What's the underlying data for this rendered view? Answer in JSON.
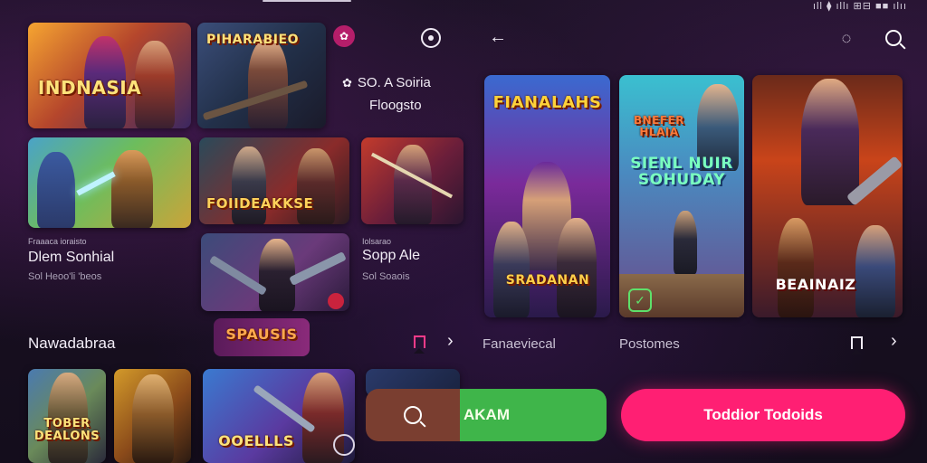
{
  "status_bar": {
    "text": "ıll ⧫ ıllı ⊞⊟ ■■ ılıı"
  },
  "left_panel": {
    "side_title": "SO. A Soiria",
    "side_subtitle": "Floogsto",
    "game_titles": {
      "g1": "INDNASIA",
      "g2": "PIHARABIEO",
      "g3": "",
      "g4": "FOIIDEAKKSE",
      "g5": "",
      "g6": "",
      "g7": "SPAUSIS",
      "g8": "TOBER DEALONS",
      "g9": "",
      "g10": "OOELLLS"
    },
    "item_a": {
      "tag": "Fraaaca ioraisto",
      "name": "Dlem Sonhial",
      "meta": "Sol Heoo'li 'beos"
    },
    "item_b": {
      "tag": "Iolsarao",
      "name": "Sopp Ale",
      "meta": "Sol Soaois"
    },
    "section_title": "Nawadabraa"
  },
  "right_panel": {
    "featured_titles": {
      "f1": "FIANALAHS",
      "f1b": "SRADANAN",
      "f2": "SIENL NUIR SOHUDAY",
      "f2top": "BNEFER HLAIA",
      "f3": "BEAINAIZ"
    },
    "label_left": "Fanaeviecal",
    "label_right": "Postomes"
  },
  "search": {
    "label": "AKAM"
  },
  "cta": {
    "label": "Toddior Todoids"
  },
  "icons": {
    "back_left": "arrow-left-icon",
    "back_right": "arrow-left-icon",
    "badge": "gift-icon",
    "chat": "chat-icon",
    "search": "search-icon",
    "bookmark": "bookmark-icon",
    "chevron": "chevron-right-icon"
  },
  "colors": {
    "accent": "#ff1f73",
    "search_green": "#3fb54a",
    "search_brown": "#7a3e30",
    "bg": "#17101f"
  }
}
